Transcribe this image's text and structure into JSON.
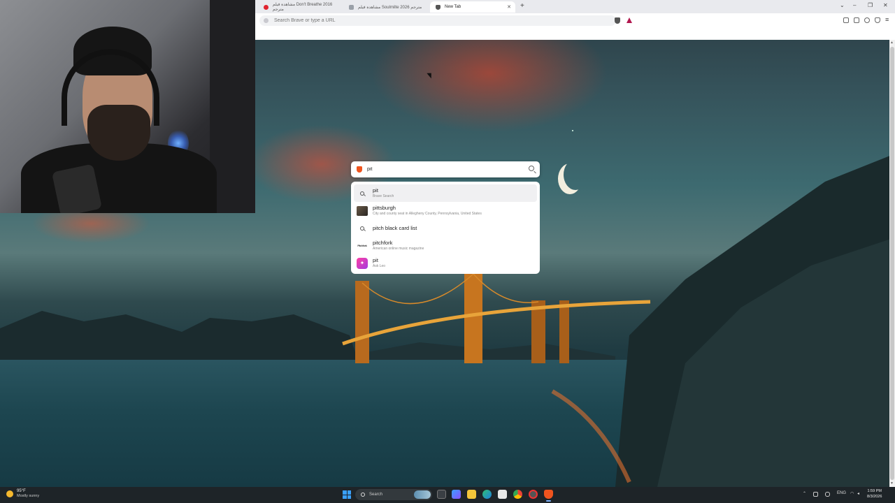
{
  "browser": {
    "tabs": [
      {
        "label": "مشاهدة فيلم Don't Breathe 2016 مترجم",
        "favicon": "red-circle-icon"
      },
      {
        "label": "مشاهدة فيلم Soulmilte 2026 مترجم",
        "favicon": "site-icon"
      },
      {
        "label": "New Tab",
        "favicon": "brave-shield-icon",
        "active": true
      }
    ],
    "url_placeholder": "Search Brave or type a URL",
    "accent": "#f0541e"
  },
  "newtab": {
    "search_value": "pit",
    "suggestions": [
      {
        "title": "pit",
        "subtitle": "Brave Search",
        "icon": "search-icon",
        "selected": true
      },
      {
        "title": "pittsburgh",
        "subtitle": "City and county seat in Allegheny County, Pennsylvania, United States",
        "icon": "city-thumbnail"
      },
      {
        "title": "pitch black card list",
        "subtitle": "",
        "icon": "search-icon"
      },
      {
        "title": "pitchfork",
        "subtitle": "American online music magazine",
        "icon": "pitchfork-logo"
      },
      {
        "title": "pit",
        "subtitle": "Ask Leo",
        "icon": "leo-ai-icon"
      }
    ],
    "pitchfork_logo_text": "Pitchfork"
  },
  "taskbar": {
    "weather_temp": "95°F",
    "weather_desc": "Mostly sunny",
    "search_label": "Search",
    "language": "ENG",
    "time": "1:59 PM",
    "date": "8/3/2026"
  }
}
